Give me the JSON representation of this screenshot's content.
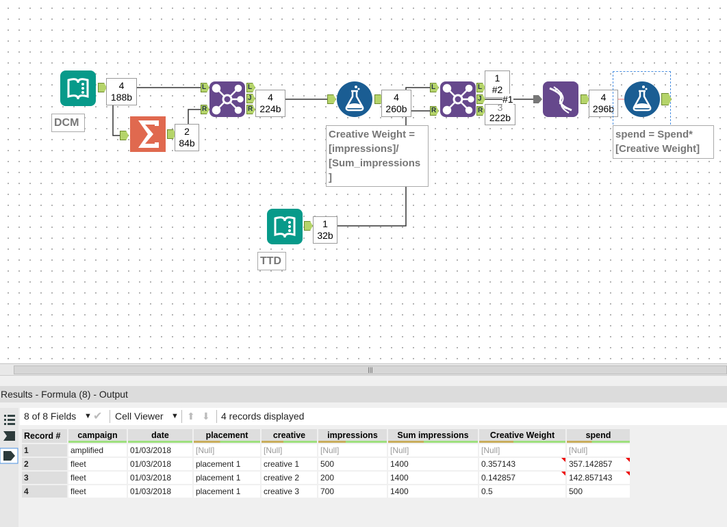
{
  "canvas": {
    "tools": [
      {
        "id": "dcm-input",
        "type": "input-data",
        "label": "DCM",
        "badge": [
          "4",
          "188b"
        ],
        "color": "#079a8a"
      },
      {
        "id": "summarize",
        "type": "summarize",
        "badge": [
          "2",
          "84b"
        ],
        "color": "#e0694f"
      },
      {
        "id": "join-1",
        "type": "join",
        "badge": [
          "4",
          "224b"
        ],
        "color": "#66488c"
      },
      {
        "id": "formula-1",
        "type": "formula",
        "badge": [
          "4",
          "260b"
        ],
        "annotation": "Creative Weight = [impressions]/ [Sum_impressions ]",
        "color": "#1a5d93"
      },
      {
        "id": "join-2",
        "type": "join",
        "badge_top": [
          "1",
          "#2"
        ],
        "badge_bottom": [
          "3",
          "222b"
        ],
        "connection_label": "#1",
        "color": "#66488c"
      },
      {
        "id": "auto-field",
        "type": "auto-field",
        "badge": [
          "4",
          "296b"
        ],
        "color": "#66488c"
      },
      {
        "id": "formula-2",
        "type": "formula",
        "annotation": "spend = Spend* [Creative Weight]",
        "color": "#1a5d93"
      },
      {
        "id": "ttd-input",
        "type": "input-data",
        "label": "TTD",
        "badge": [
          "1",
          "32b"
        ],
        "color": "#079a8a"
      }
    ],
    "anchors": {
      "L": "L",
      "R": "R",
      "J": "J"
    }
  },
  "results": {
    "title": "Results - Formula (8) - Output",
    "fields_label": "8 of 8 Fields",
    "viewer_label": "Cell Viewer",
    "records_label": "4 records displayed",
    "columns": [
      "Record #",
      "campaign",
      "date",
      "placement",
      "creative",
      "impressions",
      "Sum impressions",
      "Creative Weight",
      "spend"
    ],
    "rows": [
      [
        "1",
        "amplified",
        "01/03/2018",
        "[Null]",
        "[Null]",
        "[Null]",
        "[Null]",
        "[Null]",
        "[Null]"
      ],
      [
        "2",
        "fleet",
        "01/03/2018",
        "placement 1",
        "creative 1",
        "500",
        "1400",
        "0.357143",
        "357.142857"
      ],
      [
        "3",
        "fleet",
        "01/03/2018",
        "placement 1",
        "creative 2",
        "200",
        "1400",
        "0.142857",
        "142.857143"
      ],
      [
        "4",
        "fleet",
        "01/03/2018",
        "placement 1",
        "creative 3",
        "700",
        "1400",
        "0.5",
        "500"
      ]
    ]
  }
}
